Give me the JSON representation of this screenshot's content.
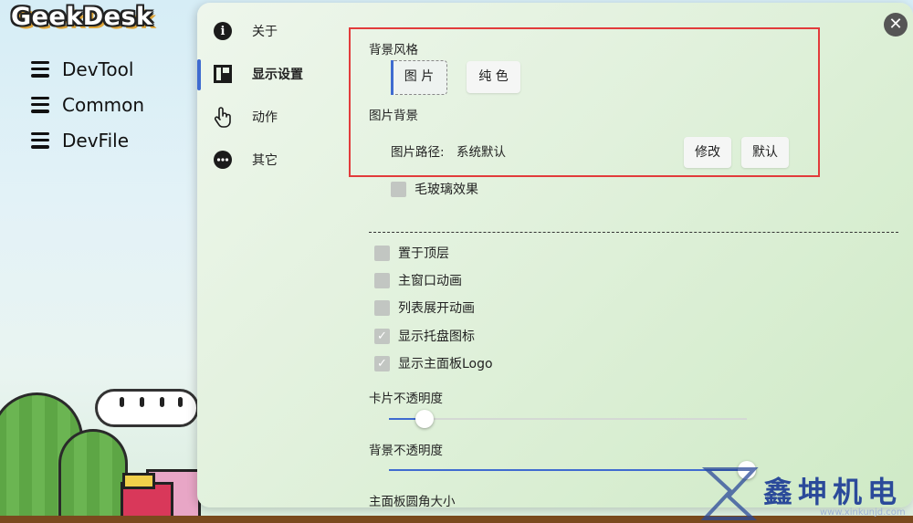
{
  "app": {
    "logo": "GeekDesk"
  },
  "menus": [
    {
      "label": "DevTool"
    },
    {
      "label": "Common"
    },
    {
      "label": "DevFile"
    }
  ],
  "nav": [
    {
      "label": "关于",
      "icon": "info-icon"
    },
    {
      "label": "显示设置",
      "icon": "layout-icon",
      "active": true
    },
    {
      "label": "动作",
      "icon": "hand-pointer-icon"
    },
    {
      "label": "其它",
      "icon": "more-icon"
    }
  ],
  "settings": {
    "bg_style": {
      "title": "背景风格",
      "options": [
        {
          "label": "图 片",
          "selected": true
        },
        {
          "label": "纯 色",
          "selected": false
        }
      ]
    },
    "bg_image": {
      "title": "图片背景",
      "path_label": "图片路径:",
      "path_value": "系统默认",
      "modify_label": "修改",
      "default_label": "默认"
    },
    "frosted": {
      "label": "毛玻璃效果",
      "checked": false
    },
    "options": [
      {
        "label": "置于顶层",
        "checked": false
      },
      {
        "label": "主窗口动画",
        "checked": false
      },
      {
        "label": "列表展开动画",
        "checked": false
      },
      {
        "label": "显示托盘图标",
        "checked": true
      },
      {
        "label": "显示主面板Logo",
        "checked": true
      }
    ],
    "sliders": [
      {
        "label": "卡片不透明度",
        "value": 0.1
      },
      {
        "label": "背景不透明度",
        "value": 1.0
      }
    ],
    "corner_label": "主面板圆角大小"
  },
  "watermark": {
    "text": "鑫坤机电",
    "sub": "www.xinkunjd.com"
  },
  "colors": {
    "accent": "#3f6bd0",
    "highlight_box": "#e23b3b",
    "checkbox": "#c2c6c2"
  }
}
